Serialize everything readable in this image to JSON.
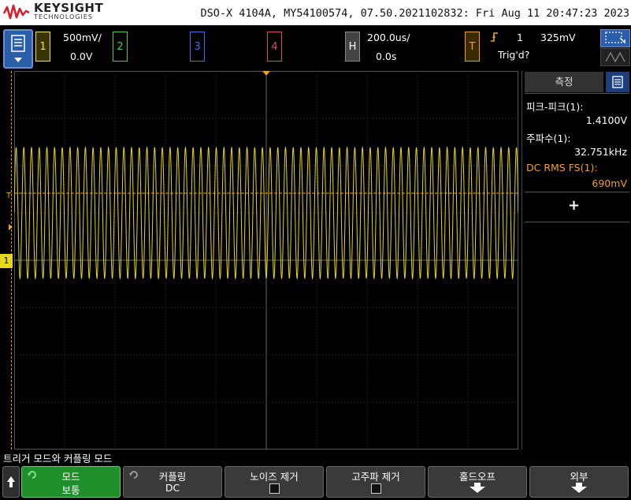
{
  "header": {
    "brand": "KEYSIGHT",
    "brand_sub": "TECHNOLOGIES",
    "instrument_line": "DSO-X 4104A, MY54100574, 07.50.2021102832: Fri Aug 11 20:47:23 2023"
  },
  "channels": [
    {
      "num": "1",
      "scale": "500mV/",
      "offset": "0.0V",
      "color": "#f2e24c"
    },
    {
      "num": "2",
      "color": "#3ecf5a"
    },
    {
      "num": "3",
      "color": "#4a6cf0"
    },
    {
      "num": "4",
      "color": "#e0456e"
    }
  ],
  "horizontal": {
    "label": "H",
    "timebase": "200.0us/",
    "delay": "0.0s"
  },
  "trigger": {
    "label": "T",
    "source": "1",
    "level": "325mV",
    "status": "Trig'd?"
  },
  "side_panel": {
    "tab_label": "측정",
    "measurements": [
      {
        "label": "피크-피크(1):",
        "value": "1.4100V",
        "color": "#ffffff"
      },
      {
        "label": "주파수(1):",
        "value": "32.751kHz",
        "color": "#ffffff"
      },
      {
        "label": "DC RMS FS(1):",
        "value": "690mV",
        "color": "#f0a020"
      }
    ],
    "add_symbol": "+"
  },
  "waveform": {
    "channel": "1",
    "color": "#e6d61e",
    "trigger_level_color": "#f0a020",
    "ground_marker": "1",
    "trigger_marker": "T"
  },
  "softkeys": {
    "title": "트리거 모드와 커플링 모드",
    "back_icon": "up-arrow-icon",
    "keys": [
      {
        "label": "모드",
        "value": "보통"
      },
      {
        "label": "커플링",
        "value": "DC"
      },
      {
        "label": "노이즈 제거",
        "value": ""
      },
      {
        "label": "고주파 제거",
        "value": ""
      },
      {
        "label": "홀드오프",
        "value": ""
      },
      {
        "label": "외부",
        "value": ""
      }
    ]
  }
}
